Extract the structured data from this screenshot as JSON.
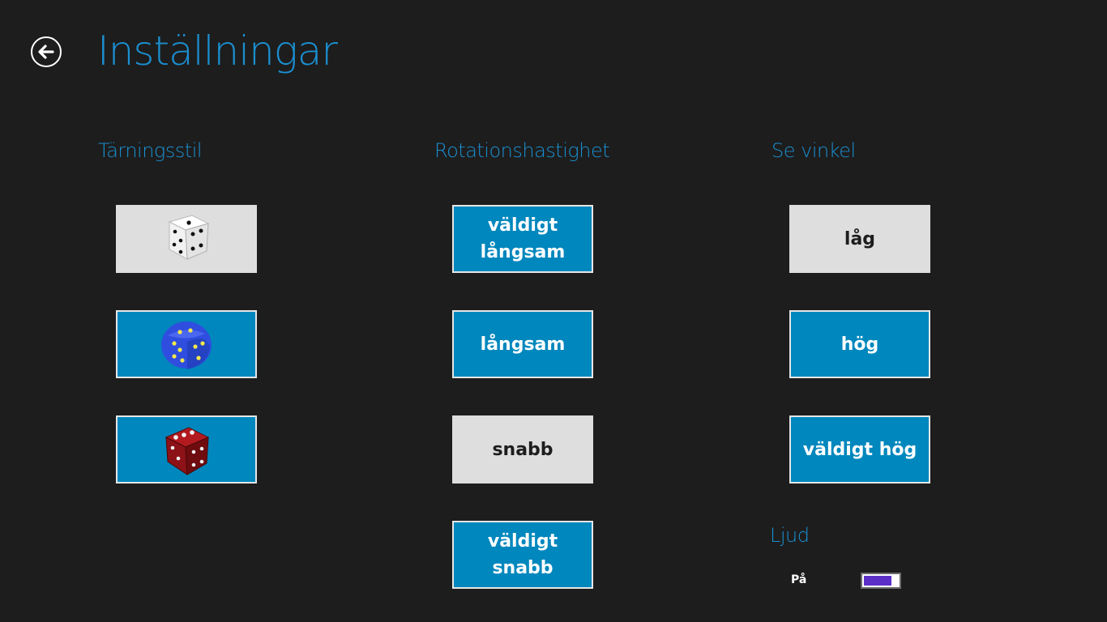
{
  "header": {
    "title": "Inställningar",
    "back_icon": "back-arrow-icon"
  },
  "dice_style": {
    "title": "Tärningsstil",
    "options": [
      {
        "name": "white-die-icon",
        "selected": false
      },
      {
        "name": "blue-die-icon",
        "selected": true
      },
      {
        "name": "red-die-icon",
        "selected": true
      }
    ]
  },
  "rotation_speed": {
    "title": "Rotationshastighet",
    "options": [
      {
        "label": "väldigt\nlångsam",
        "selected": true
      },
      {
        "label": "långsam",
        "selected": true
      },
      {
        "label": "snabb",
        "selected": false
      },
      {
        "label": "väldigt\nsnabb",
        "selected": true
      }
    ]
  },
  "view_angle": {
    "title": "Se vinkel",
    "options": [
      {
        "label": "låg",
        "selected": false
      },
      {
        "label": "hög",
        "selected": true
      },
      {
        "label": "väldigt hög",
        "selected": true
      }
    ]
  },
  "sound": {
    "title": "Ljud",
    "state_label": "På",
    "on": true,
    "accent": "#5b2ec8"
  },
  "colors": {
    "accent": "#1b8fd0",
    "selected_bg": "#0087bd",
    "unselected_bg": "#dedede",
    "background": "#1d1d1d"
  }
}
